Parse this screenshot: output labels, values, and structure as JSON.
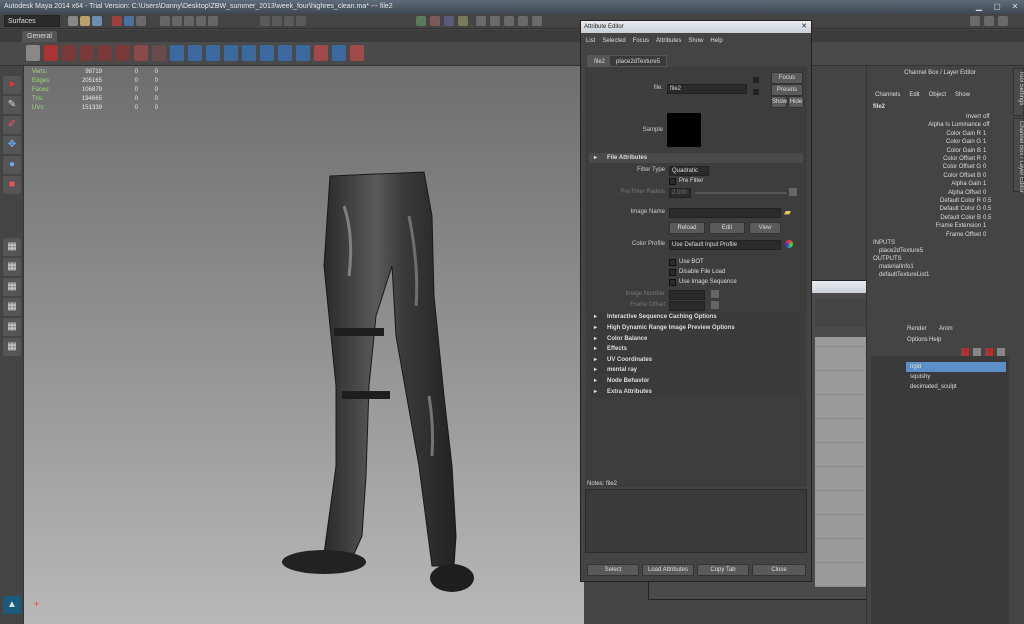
{
  "title": "Autodesk Maya 2014 x64 - Trial Version: C:\\Users\\Danny\\Desktop\\ZBW_summer_2013\\week_four\\highres_clean.ma* --- file2",
  "menuset": "Surfaces",
  "shelf_tab": "General",
  "hud": {
    "rows": [
      {
        "label": "Verts:",
        "v1": "98719",
        "v2": "0",
        "v3": "0"
      },
      {
        "label": "Edges:",
        "v1": "205165",
        "v2": "0",
        "v3": "0"
      },
      {
        "label": "Faces:",
        "v1": "106879",
        "v2": "0",
        "v3": "0"
      },
      {
        "label": "Tris:",
        "v1": "194665",
        "v2": "0",
        "v3": "0"
      },
      {
        "label": "UVs:",
        "v1": "151339",
        "v2": "0",
        "v3": "0"
      }
    ]
  },
  "attribute_editor": {
    "title": "Attribute Editor",
    "menu": [
      "List",
      "Selected",
      "Focus",
      "Attributes",
      "Show",
      "Help"
    ],
    "tabs": [
      "file2",
      "place2dTexture5"
    ],
    "file_label": "file:",
    "file_value": "file2",
    "focus": "Focus",
    "presets": "Presets",
    "show": "Show",
    "hide": "Hide",
    "sample_label": "Sample",
    "section_file": "File Attributes",
    "filter_type_label": "Filter Type",
    "filter_type_value": "Quadratic",
    "pre_filter": "Pre Filter",
    "pre_filter_radius": "Pre Filter Radius",
    "pre_filter_radius_value": "2.000",
    "image_name_label": "Image Name",
    "reload": "Reload",
    "edit": "Edit",
    "view": "View",
    "color_profile_label": "Color Profile",
    "color_profile_value": "Use Default Input Profile",
    "use_bot": "Use BOT",
    "disable_file_load": "Disable File Load",
    "use_image_sequence": "Use Image Sequence",
    "image_number": "Image Number",
    "frame_offset": "Frame Offset",
    "sections": [
      "Interactive Sequence Caching Options",
      "High Dynamic Range Image Preview Options",
      "Color Balance",
      "Effects",
      "UV Coordinates",
      "mental ray",
      "Node Behavior",
      "Extra Attributes"
    ],
    "notes": "Notes:  file2",
    "buttons": [
      "Select",
      "Load Attributes",
      "Copy Tab",
      "Close"
    ]
  },
  "channel_box": {
    "title": "Channel Box / Layer Editor",
    "menu": [
      "Channels",
      "Edit",
      "Object",
      "Show"
    ],
    "node": "file2",
    "channels": [
      {
        "name": "Invert",
        "value": "off"
      },
      {
        "name": "Alpha Is Luminance",
        "value": "off"
      },
      {
        "name": "Color Gain R",
        "value": "1"
      },
      {
        "name": "Color Gain G",
        "value": "1"
      },
      {
        "name": "Color Gain B",
        "value": "1"
      },
      {
        "name": "Color Offset R",
        "value": "0"
      },
      {
        "name": "Color Offset G",
        "value": "0"
      },
      {
        "name": "Color Offset B",
        "value": "0"
      },
      {
        "name": "Alpha Gain",
        "value": "1"
      },
      {
        "name": "Alpha Offset",
        "value": "0"
      },
      {
        "name": "Default Color R",
        "value": "0.5"
      },
      {
        "name": "Default Color G",
        "value": "0.5"
      },
      {
        "name": "Default Color B",
        "value": "0.5"
      },
      {
        "name": "Frame Extension",
        "value": "1"
      },
      {
        "name": "Frame Offset",
        "value": "0"
      }
    ],
    "inputs_label": "INPUTS",
    "inputs": "place2dTexture5",
    "outputs_label": "OUTPUTS",
    "outputs": [
      "materialInfo1",
      "defaultTextureList1"
    ],
    "layer_tabs": [
      "Render",
      "Anim"
    ],
    "layer_menu": [
      "Options",
      "Help"
    ],
    "layers": [
      "rigid",
      "squishy",
      "decimated_sculpt"
    ],
    "side_tabs": [
      "Tool Settings",
      "Channel Box / Layer Editor"
    ]
  }
}
